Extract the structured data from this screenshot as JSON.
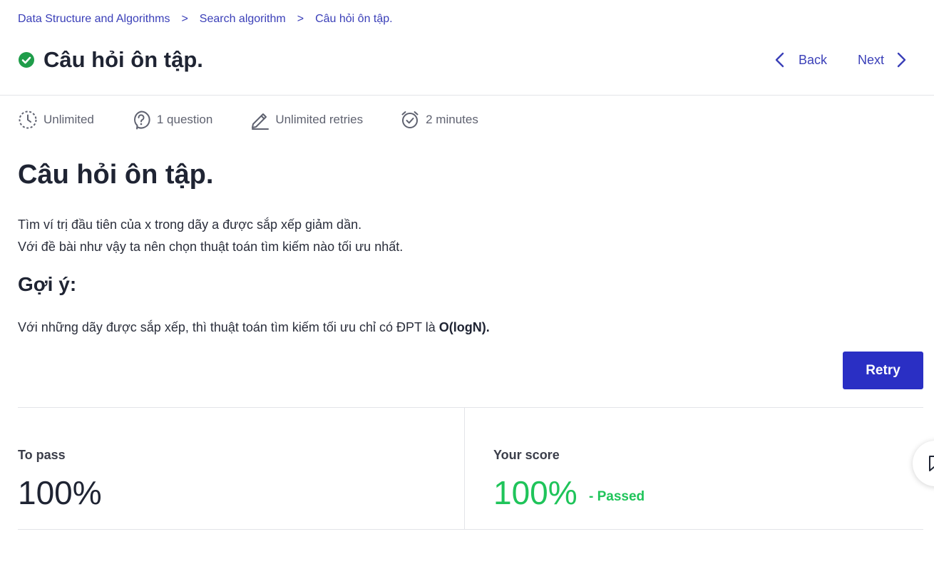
{
  "breadcrumb": {
    "items": [
      "Data Structure and Algorithms",
      "Search algorithm",
      "Câu hỏi ôn tập."
    ],
    "separator": ">"
  },
  "header": {
    "title": "Câu hỏi ôn tập.",
    "back_label": "Back",
    "next_label": "Next",
    "status_icon": "check-circle-icon",
    "status_color": "#1f9d4a"
  },
  "meta": {
    "time_limit": "Unlimited",
    "questions": "1 question",
    "retries": "Unlimited retries",
    "duration": "2 minutes"
  },
  "content": {
    "title": "Câu hỏi ôn tập.",
    "line1": "Tìm ví trị đầu tiên của x trong dãy a được sắp xếp giảm dần.",
    "line2": "Với đề bài như vậy ta nên chọn thuật toán tìm kiếm nào tối ưu nhất.",
    "hint_title": "Gợi ý:",
    "hint_text": "Với những dãy được sắp xếp, thì thuật toán tìm kiếm tối ưu chỉ có ĐPT là ",
    "hint_bold": "O(logN)."
  },
  "actions": {
    "retry_label": "Retry"
  },
  "score": {
    "to_pass_label": "To pass",
    "to_pass_value": "100%",
    "your_score_label": "Your score",
    "your_score_value": "100%",
    "status": "- Passed"
  },
  "colors": {
    "accent": "#2a2fc4",
    "link": "#3a3fb8",
    "success": "#1fc45a"
  }
}
